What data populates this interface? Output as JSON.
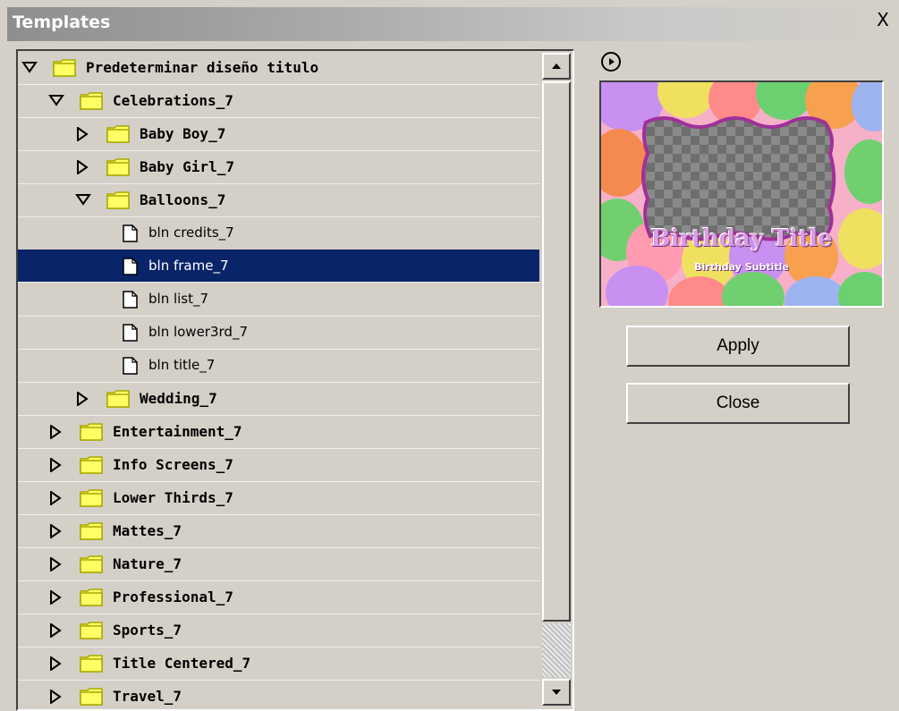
{
  "window": {
    "title": "Templates",
    "close_label": "X"
  },
  "tree": {
    "rows": [
      {
        "label": "Predeterminar diseño titulo",
        "type": "folder",
        "expanded": true,
        "depth": 0
      },
      {
        "label": "Celebrations_7",
        "type": "folder",
        "expanded": true,
        "depth": 1
      },
      {
        "label": "Baby Boy_7",
        "type": "folder",
        "expanded": false,
        "depth": 2
      },
      {
        "label": "Baby Girl_7",
        "type": "folder",
        "expanded": false,
        "depth": 2
      },
      {
        "label": "Balloons_7",
        "type": "folder",
        "expanded": true,
        "depth": 2
      },
      {
        "label": "bln credits_7",
        "type": "file",
        "depth": 3
      },
      {
        "label": "bln frame_7",
        "type": "file",
        "depth": 3,
        "selected": true
      },
      {
        "label": "bln list_7",
        "type": "file",
        "depth": 3
      },
      {
        "label": "bln lower3rd_7",
        "type": "file",
        "depth": 3
      },
      {
        "label": "bln title_7",
        "type": "file",
        "depth": 3
      },
      {
        "label": "Wedding_7",
        "type": "folder",
        "expanded": false,
        "depth": 2
      },
      {
        "label": "Entertainment_7",
        "type": "folder",
        "expanded": false,
        "depth": 1
      },
      {
        "label": "Info Screens_7",
        "type": "folder",
        "expanded": false,
        "depth": 1
      },
      {
        "label": "Lower Thirds_7",
        "type": "folder",
        "expanded": false,
        "depth": 1
      },
      {
        "label": "Mattes_7",
        "type": "folder",
        "expanded": false,
        "depth": 1
      },
      {
        "label": "Nature_7",
        "type": "folder",
        "expanded": false,
        "depth": 1
      },
      {
        "label": "Professional_7",
        "type": "folder",
        "expanded": false,
        "depth": 1
      },
      {
        "label": "Sports_7",
        "type": "folder",
        "expanded": false,
        "depth": 1
      },
      {
        "label": "Title Centered_7",
        "type": "folder",
        "expanded": false,
        "depth": 1
      },
      {
        "label": "Travel_7",
        "type": "folder",
        "expanded": false,
        "depth": 1
      }
    ]
  },
  "preview": {
    "title_text": "Birthday Title",
    "subtitle_text": "Birthday Subtitle"
  },
  "buttons": {
    "apply": "Apply",
    "close": "Close"
  },
  "colors": {
    "window_bg": "#d4d0c8",
    "selection_bg": "#0a246a",
    "folder_fill": "#ffff66",
    "folder_border": "#a8a800"
  }
}
